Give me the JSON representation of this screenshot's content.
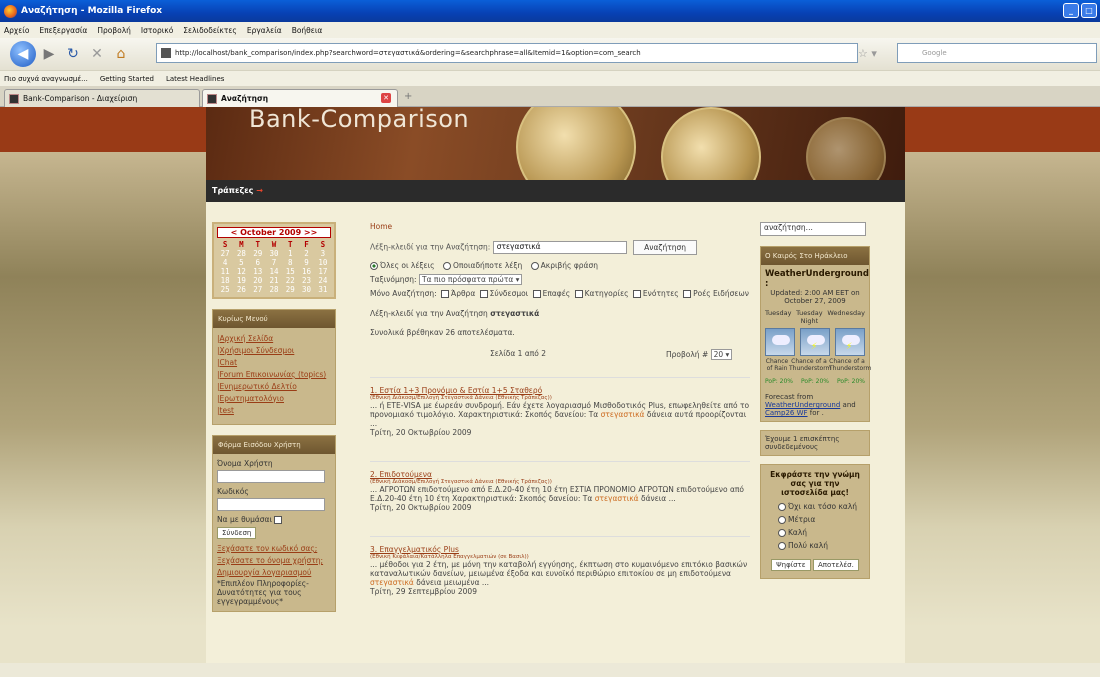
{
  "window": {
    "title": "Αναζήτηση - Mozilla Firefox"
  },
  "menu": [
    "Αρχείο",
    "Επεξεργασία",
    "Προβολή",
    "Ιστορικό",
    "Σελιδοδείκτες",
    "Εργαλεία",
    "Βοήθεια"
  ],
  "nav": {
    "url": "http://localhost/bank_comparison/index.php?searchword=στεγαστικά&ordering=&searchphrase=all&Itemid=1&option=com_search",
    "search_placeholder": "Google"
  },
  "bookmarks": [
    "Πιο συχνά αναγνωσμέ...",
    "Getting Started",
    "Latest Headlines"
  ],
  "tabs": [
    {
      "label": "Bank-Comparison - Διαχείριση",
      "active": false
    },
    {
      "label": "Αναζήτηση",
      "active": true
    }
  ],
  "site": {
    "title": "Bank-Comparison",
    "menu_item": "Τράπεζες"
  },
  "calendar": {
    "header": "< October 2009 >>",
    "weekdays": [
      "S",
      "M",
      "T",
      "W",
      "T",
      "F",
      "S"
    ],
    "weeks": [
      [
        "27",
        "28",
        "29",
        "30",
        "1",
        "2",
        "3"
      ],
      [
        "4",
        "5",
        "6",
        "7",
        "8",
        "9",
        "10"
      ],
      [
        "11",
        "12",
        "13",
        "14",
        "15",
        "16",
        "17"
      ],
      [
        "18",
        "19",
        "20",
        "21",
        "22",
        "23",
        "24"
      ],
      [
        "25",
        "26",
        "27",
        "28",
        "29",
        "30",
        "31"
      ]
    ]
  },
  "mainmenu": {
    "title": "Κυρίως Μενού",
    "items": [
      "Αρχική Σελίδα",
      "Χρήσιμοι Σύνδεσμοι",
      "Chat",
      "Forum Επικοινωνίας (topics)",
      "Ενημερωτικό Δελτίο",
      "Ερωτηματολόγιο",
      "test"
    ]
  },
  "login": {
    "title": "Φόρμα Εισόδου Χρήστη",
    "username_label": "Όνομα Χρήστη",
    "password_label": "Κωδικός",
    "remember_label": "Να με θυμάσαι",
    "submit": "Σύνδεση",
    "forgot_password": "Ξεχάσατε τον κωδικό σας;",
    "forgot_username": "Ξεχάσατε το όνομα χρήστη;",
    "register": "Δημιουργία λογαριασμού",
    "note": "*Επιπλέον Πληροφορίες-Δυνατότητες για τους εγγεγραμμένους*"
  },
  "search": {
    "breadcrumb": "Home",
    "keyword_label": "Λέξη-κλειδί για την Αναζήτηση:",
    "keyword_value": "στεγαστικά",
    "button": "Αναζήτηση",
    "radio_all": "Όλες οι λέξεις",
    "radio_any": "Οποιαδήποτε λέξη",
    "radio_exact": "Ακριβής φράση",
    "ordering_label": "Ταξινόμηση:",
    "ordering_value": "Τα πιο πρόσφατα πρώτα",
    "only_label": "Μόνο Αναζήτηση:",
    "filters": [
      "Άρθρα",
      "Σύνδεσμοι",
      "Επαφές",
      "Κατηγορίες",
      "Ενότητες",
      "Ροές Ειδήσεων"
    ],
    "summary_label": "Λέξη-κλειδί για την Αναζήτηση",
    "summary_keyword": "στεγαστικά",
    "found": "Συνολικά βρέθηκαν 26 αποτελέσματα.",
    "page_info": "Σελίδα 1 από 2",
    "display_label": "Προβολή #",
    "display_value": "20"
  },
  "results": [
    {
      "title": "1. Εστία 1+3 Προνόμιο & Εστία 1+5 Σταθερό",
      "section": "(Εθνική Διάκοσμ/Επιλογή Στεγαστικά Δάνεια (Εθνικής Τράπεζας))",
      "pre": "... ή ΕΤΕ-VISA με έωρεάν συνδρομή. Εάν έχετε λογαριασμό Μισθοδοτικός Plus, επωφεληθείτε από το προνομιακό τιμολόγιο. Χαρακτηριστικά: Σκοπός δανείου: Τα ",
      "kw": "στεγαστικά",
      "post": " δάνεια αυτά προορίζονται ...",
      "date": "Τρίτη, 20 Οκτωβρίου 2009"
    },
    {
      "title": "2. Επιδοτούμενα",
      "section": "(Εθνική Διάκοσμ/Επιλογή Στεγαστικά Δάνεια (Εθνικής Τράπεζας))",
      "pre": "... ΑΓΡΟΤΩΝ επιδοτούμενο από Ε.Δ.20-40 έτη 10 έτη ΕΣΤΙΑ ΠΡΟΝΟΜΙΟ ΑΓΡΟΤΩΝ επιδοτούμενο από Ε.Δ.20-40 έτη 10 έτη Χαρακτηριστικά: Σκοπός δανείου: Τα ",
      "kw": "στεγαστικά",
      "post": " δάνεια ...",
      "date": "Τρίτη, 20 Οκτωβρίου 2009"
    },
    {
      "title": "3. Επαγγελματικός Plus",
      "section": "(Εθνική Κεφάλαια/Κατάλληλα Επαγγελματιών (σε Βασιλ))",
      "pre": "... μέθοδοι για 2 έτη, με μόνη την καταβολή εγγύησης, έκπτωση στο κυμαινόμενο επιτόκιο βασικών καταναλωτικών δανείων, μειωμένα έξοδα και ευνοϊκό περιθώριο επιτοκίου σε μη επιδοτούμενα ",
      "kw": "στεγαστικά",
      "post": " δάνεια μειωμένα ...",
      "date": "Τρίτη, 29 Σεπτεμβρίου 2009"
    }
  ],
  "right": {
    "search_value": "αναζήτηση...",
    "weather_box_title": "Ο Καιρός Στο Ηράκλειο",
    "weather_title": "WeatherUnderground :",
    "updated": "Updated: 2:00 AM EET on October 27, 2009",
    "days": [
      "Tuesday",
      "Tuesday Night",
      "Wednesday"
    ],
    "conditions": [
      "Chance of Rain",
      "Chance of a Thunderstorm",
      "Chance of a Thunderstorm"
    ],
    "pops": [
      "PoP: 20%",
      "PoP: 20%",
      "PoP: 20%"
    ],
    "forecast_from": "Forecast from",
    "wu_link": "WeatherUnderground",
    "and": "and",
    "camp_link": "Camp26 WF",
    "for": "for .",
    "online": "Έχουμε 1 επισκέπτης συνδεδεμένους",
    "poll_question": "Εκφράστε την γνώμη σας για την ιστοσελίδα μας!",
    "poll_options": [
      "Όχι και τόσο καλή",
      "Μέτρια",
      "Καλή",
      "Πολύ καλή"
    ],
    "vote": "Ψηφίστε",
    "results": "Αποτελέσ."
  }
}
